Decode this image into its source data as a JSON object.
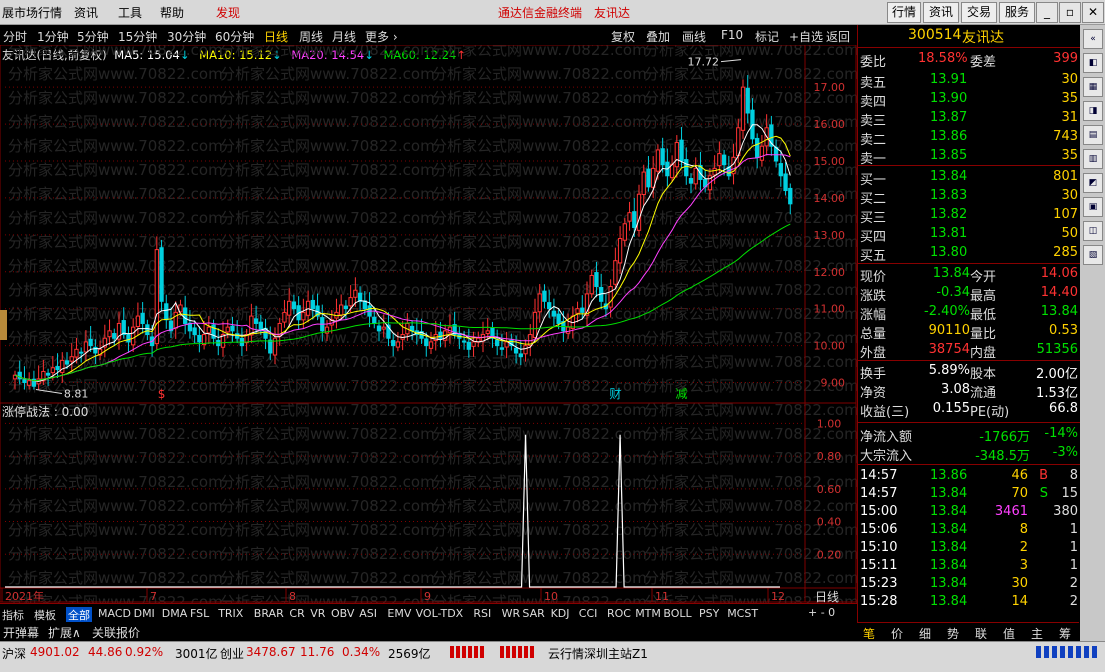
{
  "menubar": {
    "items": [
      "展市场行情",
      "资讯",
      "工具",
      "帮助"
    ],
    "discover": "发现",
    "center_title": "通达信金融终端",
    "center_subtitle": "友讯达",
    "buttons": [
      "行情",
      "资讯",
      "交易",
      "服务"
    ]
  },
  "periods": {
    "items": [
      "分时",
      "1分钟",
      "5分钟",
      "15分钟",
      "30分钟",
      "60分钟",
      "日线",
      "周线",
      "月线",
      "更多 ›"
    ],
    "active_index": 6,
    "right_buttons": [
      "复权",
      "叠加",
      "画线",
      "F10",
      "标记",
      "+自选",
      "返回"
    ]
  },
  "ma_legend": {
    "stock": "友讯达(日线,前复权)",
    "ma5": "MA5: 15.04",
    "ma10": "MA10: 15.12",
    "ma20": "MA20: 14.54",
    "ma60": "MA60: 12.24"
  },
  "price_axis": [
    "17.00",
    "16.00",
    "15.00",
    "14.00",
    "13.00",
    "12.00",
    "11.00",
    "10.00",
    "9.00"
  ],
  "indicator": {
    "label": "涨停战法 : 0.00",
    "axis": [
      "1.00",
      "0.80",
      "0.60",
      "0.40",
      "0.20"
    ]
  },
  "annotations": {
    "high": "17.72",
    "low": "8.81",
    "markers": [
      "$",
      "财",
      "减"
    ]
  },
  "time_axis": {
    "labels": [
      "2021年",
      "7",
      "8",
      "9",
      "10",
      "11",
      "12"
    ],
    "right": "日线"
  },
  "watermark": "分析家公式网www.70822.com",
  "quote": {
    "code": "300514",
    "name": "友讯达",
    "weibi_label": "委比",
    "weibi_value": "18.58%",
    "weicha_label": "委差",
    "weicha_value": "399",
    "asks": [
      {
        "label": "卖五",
        "price": "13.91",
        "vol": "30"
      },
      {
        "label": "卖四",
        "price": "13.90",
        "vol": "35"
      },
      {
        "label": "卖三",
        "price": "13.87",
        "vol": "31"
      },
      {
        "label": "卖二",
        "price": "13.86",
        "vol": "743"
      },
      {
        "label": "卖一",
        "price": "13.85",
        "vol": "35"
      }
    ],
    "bids": [
      {
        "label": "买一",
        "price": "13.84",
        "vol": "801"
      },
      {
        "label": "买二",
        "price": "13.83",
        "vol": "30"
      },
      {
        "label": "买三",
        "price": "13.82",
        "vol": "107"
      },
      {
        "label": "买四",
        "price": "13.81",
        "vol": "50"
      },
      {
        "label": "买五",
        "price": "13.80",
        "vol": "285"
      }
    ],
    "stats": [
      {
        "l1": "现价",
        "v1": "13.84",
        "l2": "今开",
        "v2": "14.06"
      },
      {
        "l1": "涨跌",
        "v1": "-0.34",
        "l2": "最高",
        "v2": "14.40"
      },
      {
        "l1": "涨幅",
        "v1": "-2.40%",
        "l2": "最低",
        "v2": "13.84"
      },
      {
        "l1": "总量",
        "v1": "90110",
        "l2": "量比",
        "v2": "0.53"
      },
      {
        "l1": "外盘",
        "v1": "38754",
        "l2": "内盘",
        "v2": "51356"
      }
    ],
    "stats2": [
      {
        "l1": "换手",
        "v1": "5.89%",
        "l2": "股本",
        "v2": "2.00亿"
      },
      {
        "l1": "净资",
        "v1": "3.08",
        "l2": "流通",
        "v2": "1.53亿"
      },
      {
        "l1": "收益(三)",
        "v1": "0.155",
        "l2": "PE(动)",
        "v2": "66.8"
      }
    ],
    "flows": [
      {
        "label": "净流入额",
        "value": "-1766万",
        "pct": "-14%"
      },
      {
        "label": "大宗流入",
        "value": "-348.5万",
        "pct": "-3%"
      }
    ],
    "ticks": [
      {
        "time": "14:57",
        "price": "13.86",
        "vol": "46",
        "flag": "B",
        "count": "8"
      },
      {
        "time": "14:57",
        "price": "13.84",
        "vol": "70",
        "flag": "S",
        "count": "15"
      },
      {
        "time": "15:00",
        "price": "13.84",
        "vol": "3461",
        "flag": "",
        "count": "380"
      },
      {
        "time": "15:06",
        "price": "13.84",
        "vol": "8",
        "flag": "",
        "count": "1"
      },
      {
        "time": "15:10",
        "price": "13.84",
        "vol": "2",
        "flag": "",
        "count": "1"
      },
      {
        "time": "15:11",
        "price": "13.84",
        "vol": "3",
        "flag": "",
        "count": "1"
      },
      {
        "time": "15:23",
        "price": "13.84",
        "vol": "30",
        "flag": "",
        "count": "2"
      },
      {
        "time": "15:28",
        "price": "13.84",
        "vol": "14",
        "flag": "",
        "count": "2"
      }
    ]
  },
  "right_tabs": [
    "笔",
    "价",
    "细",
    "势",
    "联",
    "值",
    "主",
    "筹"
  ],
  "indicator_tabs": [
    "指标",
    "模板",
    "全部",
    "MACD",
    "DMI",
    "DMA",
    "FSL",
    "TRIX",
    "BRAR",
    "CR",
    "VR",
    "OBV",
    "ASI",
    "EMV",
    "VOL-TDX",
    "RSI",
    "WR",
    "SAR",
    "KDJ",
    "CCI",
    "ROC",
    "MTM",
    "BOLL",
    "PSY",
    "MCST"
  ],
  "sub_tabs": [
    "开弹幕",
    "扩展∧",
    "关联报价"
  ],
  "status": {
    "sh_label": "沪深",
    "sh_value": "4901.02",
    "sh_change": "44.86",
    "sh_pct": "0.92%",
    "sh_amount": "3001亿",
    "cy_label": "创业",
    "cy_value": "3478.67",
    "cy_change": "11.76",
    "cy_pct": "0.34%",
    "cy_amount": "2569亿",
    "server": "云行情深圳主站Z1"
  },
  "colors": {
    "up": "#ff3232",
    "down": "#00d0e0",
    "ma5": "#ffffff",
    "ma10": "#ffff00",
    "ma20": "#ff40ff",
    "ma60": "#00e000",
    "grid": "#800000"
  },
  "chart_data": {
    "type": "candlestick",
    "title": "友讯达(日线,前复权)",
    "x_range": [
      "2021-06",
      "2021-12"
    ],
    "ylim": [
      8.5,
      17.6
    ],
    "indicator_ylim": [
      0,
      1.1
    ],
    "indicator_spikes": [
      0.93,
      0.93
    ],
    "highest": 17.72,
    "lowest": 8.81,
    "close": [
      9.2,
      9.1,
      9.0,
      9.05,
      8.9,
      9.1,
      9.3,
      9.2,
      9.4,
      9.35,
      9.6,
      9.5,
      9.7,
      9.9,
      9.8,
      10.1,
      10.0,
      9.8,
      9.9,
      10.2,
      10.4,
      10.2,
      10.6,
      10.3,
      10.1,
      10.5,
      10.8,
      10.6,
      10.3,
      10.0,
      12.6,
      11.2,
      10.7,
      10.4,
      10.9,
      11.1,
      10.6,
      10.4,
      10.3,
      10.1,
      10.3,
      10.5,
      10.2,
      10.0,
      10.3,
      10.5,
      10.4,
      10.2,
      10.0,
      10.3,
      10.8,
      10.6,
      10.4,
      10.2,
      9.8,
      10.2,
      10.6,
      10.9,
      11.2,
      11.0,
      10.7,
      10.9,
      11.2,
      11.0,
      10.8,
      10.4,
      10.5,
      10.7,
      10.9,
      11.1,
      11.0,
      11.3,
      11.5,
      11.2,
      11.0,
      10.8,
      10.6,
      10.4,
      10.5,
      10.2,
      10.0,
      10.1,
      10.3,
      10.6,
      10.4,
      10.3,
      10.2,
      10.0,
      10.1,
      10.3,
      10.2,
      10.4,
      10.5,
      10.3,
      10.2,
      10.1,
      9.9,
      10.1,
      10.2,
      10.3,
      10.4,
      10.2,
      10.0,
      9.9,
      10.1,
      10.0,
      9.8,
      9.7,
      10.0,
      10.3,
      10.9,
      11.4,
      11.2,
      11.0,
      10.8,
      10.6,
      10.4,
      10.5,
      10.8,
      11.0,
      10.9,
      11.4,
      11.9,
      11.6,
      11.2,
      11.0,
      11.6,
      12.3,
      12.9,
      13.3,
      13.6,
      13.2,
      14.1,
      14.7,
      14.3,
      14.8,
      15.3,
      14.9,
      14.6,
      14.9,
      15.5,
      15.0,
      14.6,
      14.4,
      14.8,
      14.5,
      14.3,
      14.6,
      14.8,
      15.2,
      14.9,
      14.6,
      15.1,
      15.9,
      17.0,
      16.3,
      15.6,
      15.1,
      15.4,
      15.9,
      15.4,
      15.0,
      14.6,
      14.2,
      13.84
    ],
    "x_labels": [
      "2021年",
      "7",
      "8",
      "9",
      "10",
      "11",
      "12"
    ],
    "markers": [
      {
        "label": "$",
        "index": 31
      },
      {
        "label": "财",
        "index": 127
      },
      {
        "label": "减",
        "index": 141
      }
    ]
  }
}
